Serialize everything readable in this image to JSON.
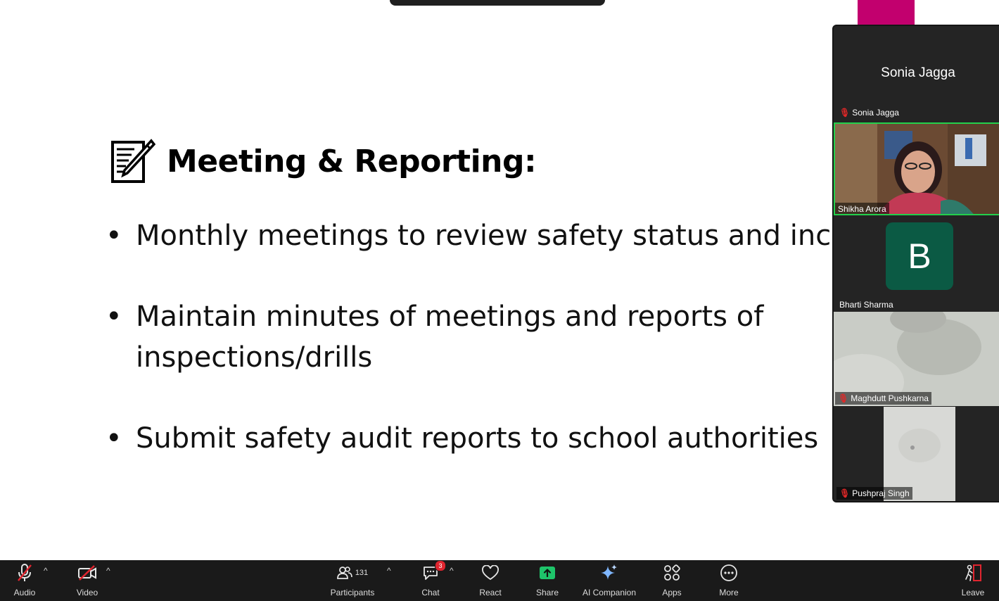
{
  "slide": {
    "title": "Meeting & Reporting:",
    "bullets": [
      {
        "lines": [
          "Monthly meetings to review safety status and incid"
        ]
      },
      {
        "lines": [
          "Maintain minutes of meetings and reports of",
          "inspections/drills"
        ]
      },
      {
        "lines": [
          "Submit safety audit reports to school authorities"
        ]
      }
    ]
  },
  "gallery": {
    "featured_name": "Sonia Jagga",
    "participants": [
      {
        "name": "Sonia Jagga",
        "muted": true
      },
      {
        "name": "Shikha Arora",
        "muted": false,
        "active_speaker": true
      },
      {
        "name": "Bharti Sharma",
        "muted": false,
        "avatar_letter": "B",
        "avatar_color": "#0b5a44"
      },
      {
        "name": "Maghdutt Pushkarna",
        "muted": true
      },
      {
        "name": "Pushpraj Singh",
        "muted": true
      }
    ],
    "active_speaker_color": "#23d04c"
  },
  "toolbar": {
    "audio": "Audio",
    "video": "Video",
    "participants": "Participants",
    "participants_count": "131",
    "chat": "Chat",
    "chat_badge": "3",
    "react": "React",
    "share": "Share",
    "share_color": "#1ec46a",
    "ai_companion": "AI Companion",
    "apps": "Apps",
    "more": "More",
    "leave": "Leave"
  }
}
